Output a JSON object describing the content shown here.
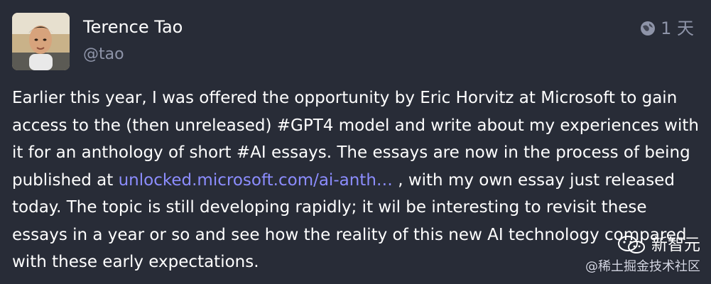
{
  "status": {
    "author": {
      "display_name": "Terence Tao",
      "username": "@tao"
    },
    "meta": {
      "visibility_icon": "globe-icon",
      "timestamp": "1 天"
    },
    "content": {
      "part1": "Earlier this year, I was offered the opportunity by Eric Horvitz at Microsoft to gain access to the (then unreleased) #GPT4 model and write about my experiences with it for an anthology of short #AI essays.  The essays are now in the process of being published at ",
      "link_text": "unlocked.microsoft.com/ai-anth…",
      "part2": " , with my own essay just released today.  The topic is still developing rapidly; it wil be interesting to revisit these essays in a year or so and see how the reality of this new AI technology compared with these early expectations."
    }
  },
  "watermark": {
    "brand": "新智元",
    "community": "@稀土掘金技术社区"
  },
  "colors": {
    "background": "#282c37",
    "text": "#ffffff",
    "muted": "#8e94a8",
    "link": "#8c8dff"
  }
}
